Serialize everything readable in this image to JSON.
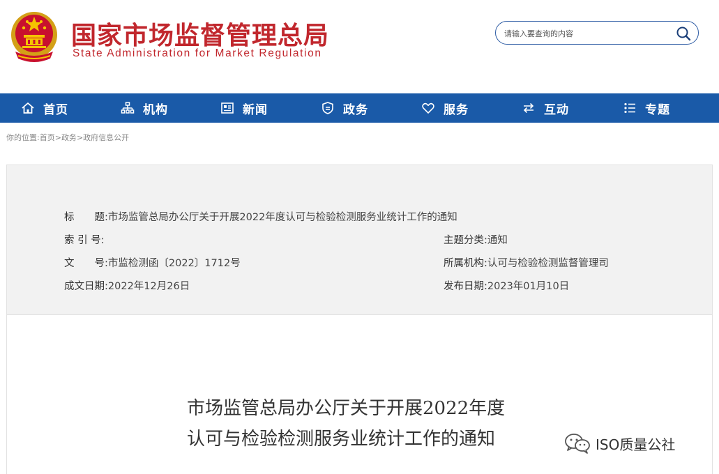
{
  "header": {
    "title": "国家市场监督管理总局",
    "subtitle": "State Administration for Market Regulation",
    "search_placeholder": "请输入要查询的内容"
  },
  "colors": {
    "brand_red": "#c1272d",
    "nav_blue": "#1a5aa8"
  },
  "nav": {
    "items": [
      {
        "label": "首页",
        "icon": "home-icon"
      },
      {
        "label": "机构",
        "icon": "org-chart-icon"
      },
      {
        "label": "新闻",
        "icon": "news-icon"
      },
      {
        "label": "政务",
        "icon": "government-shield-icon"
      },
      {
        "label": "服务",
        "icon": "heart-icon"
      },
      {
        "label": "互动",
        "icon": "exchange-arrows-icon"
      },
      {
        "label": "专题",
        "icon": "topic-list-icon"
      }
    ]
  },
  "breadcrumb": {
    "prefix": "你的位置:",
    "items": [
      "首页",
      "政务",
      "政府信息公开"
    ],
    "separator": ">"
  },
  "info": {
    "title_key": "标　　题:",
    "title_val": "市场监管总局办公厅关于开展2022年度认可与检验检测服务业统计工作的通知",
    "index_key": "索 引 号:",
    "index_val": "",
    "category_key": "主题分类:",
    "category_val": "通知",
    "docno_key": "文　　号:",
    "docno_val": "市监检测函〔2022〕1712号",
    "org_key": "所属机构:",
    "org_val": "认可与检验检测监督管理司",
    "written_key": "成文日期:",
    "written_val": "2022年12月26日",
    "published_key": "发布日期:",
    "published_val": "2023年01月10日"
  },
  "document": {
    "title_line1": "市场监管总局办公厅关于开展2022年度",
    "title_line2": "认可与检验检测服务业统计工作的通知"
  },
  "watermark": {
    "text": "ISO质量公社",
    "icon": "wechat-icon"
  }
}
